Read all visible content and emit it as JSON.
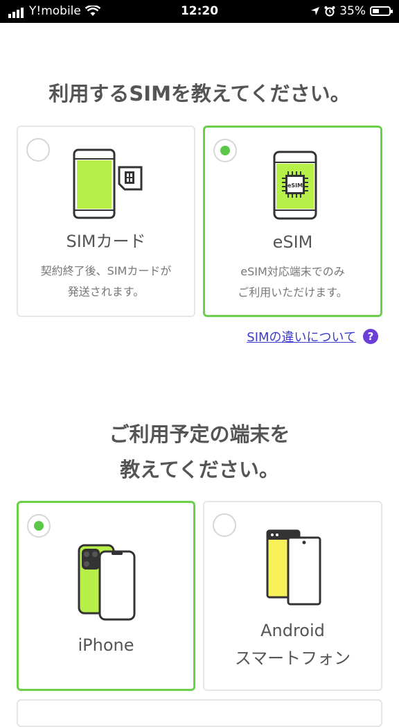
{
  "status_bar": {
    "carrier": "Y!mobile",
    "time": "12:20",
    "battery": "35%"
  },
  "sim_section": {
    "title": "利用するSIMを教えてください。",
    "options": [
      {
        "title": "SIMカード",
        "desc_line1": "契約終了後、SIMカードが",
        "desc_line2": "発送されます。",
        "selected": false
      },
      {
        "title": "eSIM",
        "desc_line1": "eSIM対応端末でのみ",
        "desc_line2": "ご利用いただけます。",
        "selected": true,
        "chip_label": "eSIM"
      }
    ],
    "link": "SIMの違いについて",
    "help": "?"
  },
  "device_section": {
    "title_line1": "ご利用予定の端末を",
    "title_line2": "教えてください。",
    "options": [
      {
        "title": "iPhone",
        "selected": true
      },
      {
        "title_line1": "Android",
        "title_line2": "スマートフォン",
        "selected": false
      }
    ]
  },
  "colors": {
    "accent_green": "#6ad04a",
    "device_green": "#b8f04a",
    "android_yellow": "#f8f25a",
    "link_blue": "#3b3bd1",
    "help_purple": "#6c3fd6"
  }
}
